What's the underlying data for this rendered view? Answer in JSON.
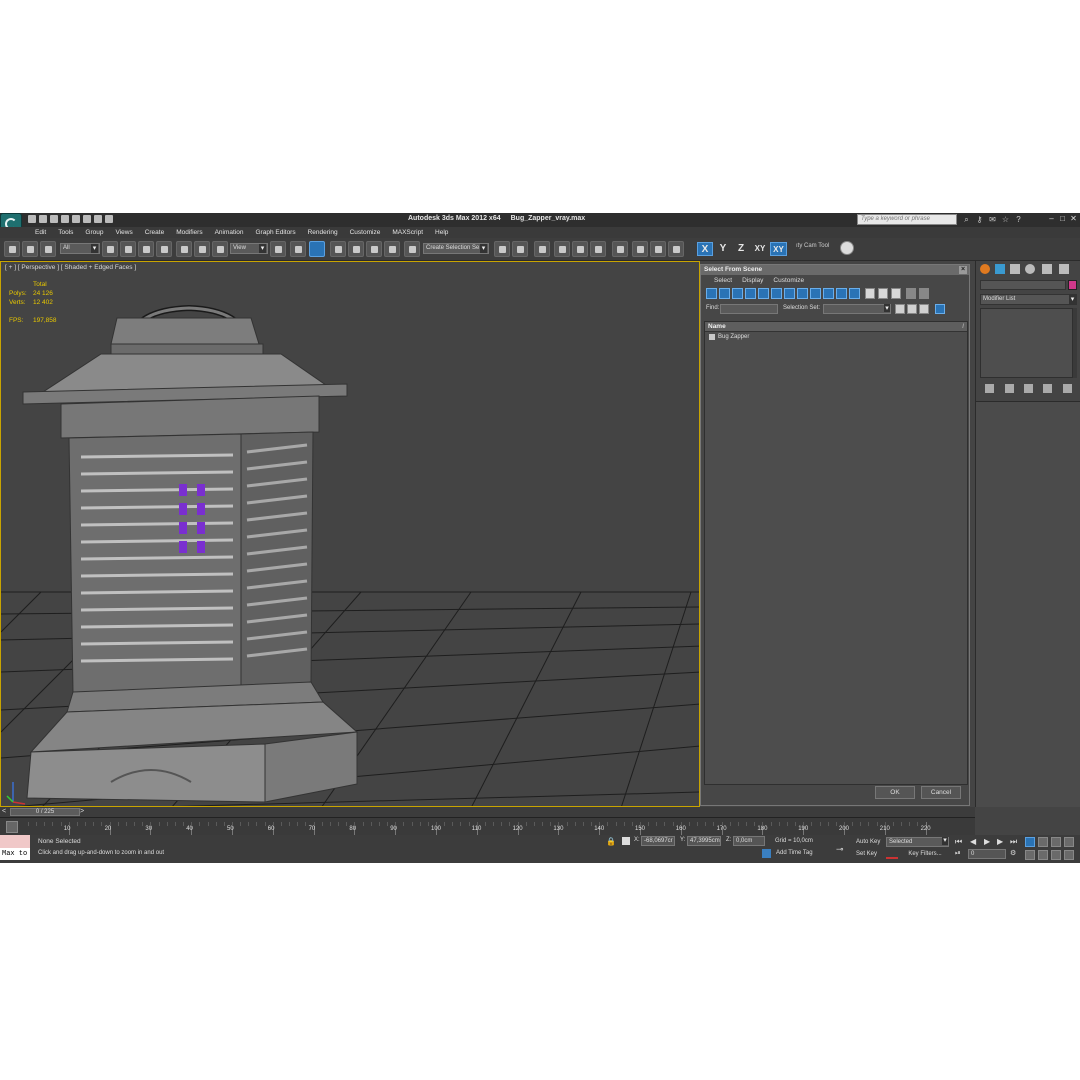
{
  "app": {
    "title": "Autodesk 3ds Max  2012 x64",
    "file": "Bug_Zapper_vray.max",
    "search_placeholder": "Type a keyword or phrase"
  },
  "menu": [
    "Edit",
    "Tools",
    "Group",
    "Views",
    "Create",
    "Modifiers",
    "Animation",
    "Graph Editors",
    "Rendering",
    "Customize",
    "MAXScript",
    "Help"
  ],
  "toolbar": {
    "filter_dropdown": "All",
    "ref_coord_dropdown": "View",
    "selection_set_dropdown": "Create Selection Se",
    "axis_x": "X",
    "axis_y": "Y",
    "axis_z": "Z",
    "axis_xy": "XY",
    "axis_xy_active": "XY",
    "cam_tool_label": "ıty Cam Tool"
  },
  "viewport": {
    "label": "[ + ] [ Perspective ] [ Shaded + Edged Faces ]",
    "stats": {
      "total_label": "Total",
      "polys_label": "Polys:",
      "polys_value": "24 126",
      "verts_label": "Verts:",
      "verts_value": "12 402",
      "fps_label": "FPS:",
      "fps_value": "197,858"
    }
  },
  "select_dialog": {
    "title": "Select From Scene",
    "menu": [
      "Select",
      "Display",
      "Customize"
    ],
    "find_label": "Find:",
    "find_value": "",
    "selection_set_label": "Selection Set:",
    "column_name": "Name",
    "sort_indicator": "/",
    "objects": [
      "Bug Zapper"
    ],
    "ok_label": "OK",
    "cancel_label": "Cancel"
  },
  "command_panel": {
    "modifier_list": "Modifier List",
    "object_color": "#d0388a"
  },
  "timeline": {
    "frame_display": "0 / 225",
    "ticks": [
      "10",
      "20",
      "30",
      "40",
      "50",
      "60",
      "70",
      "80",
      "90",
      "100",
      "110",
      "120",
      "130",
      "140",
      "150",
      "160",
      "170",
      "180",
      "190",
      "200",
      "210",
      "220"
    ]
  },
  "status": {
    "maxscript_listener": "Max to",
    "selection_info": "None Selected",
    "prompt": "Click and drag up-and-down to zoom in and out",
    "x_label": "X:",
    "x_value": "-68,0697cr",
    "y_label": "Y:",
    "y_value": "47,3995cm",
    "z_label": "Z:",
    "z_value": "0,0cm",
    "grid": "Grid = 10,0cm",
    "add_time_tag": "Add Time Tag",
    "auto_key": "Auto Key",
    "set_key": "Set Key",
    "key_mode_dropdown": "Selected",
    "key_filters": "Key Filters...",
    "current_frame": "0"
  },
  "colors": {
    "accent_blue": "#2a73b5",
    "viewport_border": "#c8a400",
    "stats_text": "#e8c800",
    "uv_light": "#7a2fd0"
  }
}
